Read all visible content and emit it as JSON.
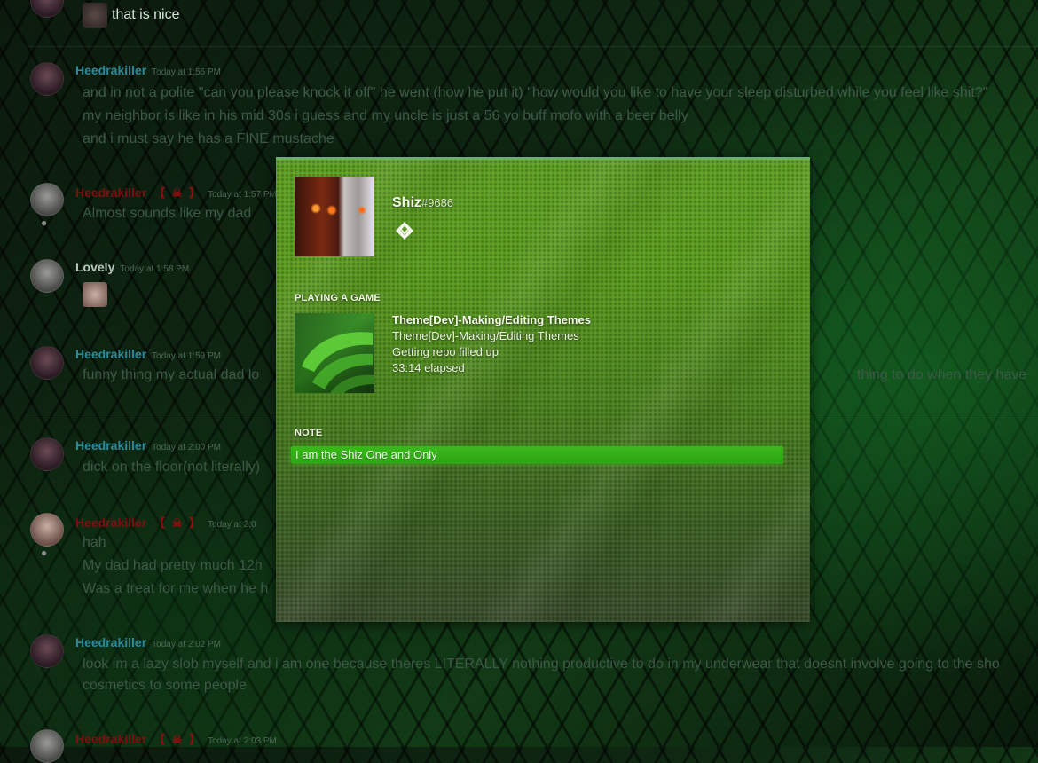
{
  "messages": [
    {
      "kind": "continuation",
      "text": "that is nice"
    },
    {
      "author": "Heedrakiller",
      "time": "Today at 1:55 PM",
      "lines": [
        "and in not a polite \"can you please knock it off\" he went (how he put it) \"how would you like to have your sleep disturbed while you feel like shit?\"",
        "my neighbor is like in his mid 30s i guess and my uncle is just a 56 yo buff mofo with a beer belly",
        "and i must say he has a FINE mustache"
      ]
    },
    {
      "author": "Heedrakiller",
      "badge": "【 ☠ 】",
      "time": "Today at 1:57 PM",
      "lines": [
        "Almost sounds like my dad"
      ]
    },
    {
      "author": "Lovely",
      "time": "Today at 1:58 PM",
      "lines": []
    },
    {
      "author": "Heedrakiller",
      "time": "Today at 1:59 PM",
      "lines": [
        "funny thing my actual dad lo",
        "thing to do when they have"
      ]
    },
    {
      "author": "Heedrakiller",
      "time": "Today at 2:00 PM",
      "lines": [
        "dick on the floor(not literally)"
      ]
    },
    {
      "author": "Heedrakiller",
      "badge": "【 ☠ 】",
      "time": "Today at 2:0",
      "lines": [
        "hah",
        "My dad had pretty much 12h",
        "Was a treat for me when he h"
      ]
    },
    {
      "author": "Heedrakiller",
      "time": "Today at 2:02 PM",
      "lines": [
        "look im a lazy slob myself and i am one because theres LITERALLY nothing productive to do in my underwear that doesnt involve going to the sho",
        "cosmetics to some people"
      ]
    },
    {
      "author": "Heedrakiller",
      "badge": "【 ☠ 】",
      "time": "Today at 2:03 PM",
      "lines": []
    }
  ],
  "popout": {
    "username": "Shiz",
    "discriminator": "#9686",
    "badge_icon": "hypesquad-diamond-icon",
    "activity_header": "PLAYING A GAME",
    "game": {
      "name": "Theme[Dev]-Making/Editing Themes",
      "details": "Theme[Dev]-Making/Editing Themes",
      "state": "Getting repo filled up",
      "elapsed": "33:14 elapsed"
    },
    "note_header": "NOTE",
    "note_value": "I am the Shiz One and Only"
  },
  "colors": {
    "accent": "#39b81a",
    "popout_top": "#5f9e24",
    "username_link": "#2b8a9c"
  }
}
